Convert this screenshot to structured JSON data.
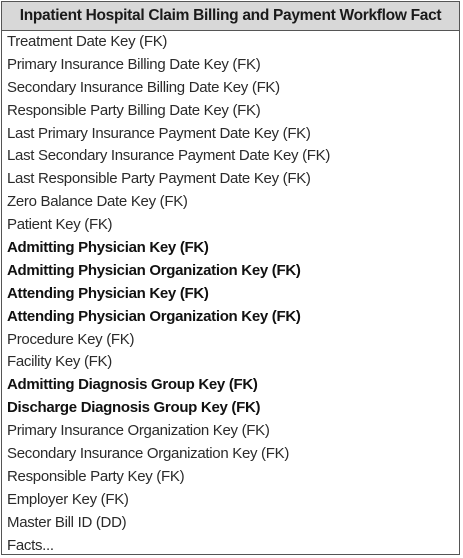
{
  "table": {
    "title": "Inpatient Hospital Claim Billing and Payment Workflow Fact",
    "rows": [
      {
        "label": "Treatment Date Key (FK)",
        "bold": false
      },
      {
        "label": "Primary Insurance Billing Date Key (FK)",
        "bold": false
      },
      {
        "label": "Secondary Insurance Billing Date Key (FK)",
        "bold": false
      },
      {
        "label": "Responsible Party Billing Date Key (FK)",
        "bold": false
      },
      {
        "label": "Last Primary Insurance Payment Date Key (FK)",
        "bold": false
      },
      {
        "label": "Last Secondary Insurance Payment Date Key (FK)",
        "bold": false
      },
      {
        "label": "Last Responsible Party Payment Date Key (FK)",
        "bold": false
      },
      {
        "label": "Zero Balance Date Key (FK)",
        "bold": false
      },
      {
        "label": "Patient Key (FK)",
        "bold": false
      },
      {
        "label": "Admitting Physician Key (FK)",
        "bold": true
      },
      {
        "label": "Admitting Physician Organization Key (FK)",
        "bold": true
      },
      {
        "label": "Attending Physician Key (FK)",
        "bold": true
      },
      {
        "label": "Attending Physician Organization Key (FK)",
        "bold": true
      },
      {
        "label": "Procedure Key (FK)",
        "bold": false
      },
      {
        "label": "Facility Key (FK)",
        "bold": false
      },
      {
        "label": "Admitting Diagnosis Group Key (FK)",
        "bold": true
      },
      {
        "label": "Discharge Diagnosis Group Key (FK)",
        "bold": true
      },
      {
        "label": "Primary Insurance Organization Key (FK)",
        "bold": false
      },
      {
        "label": "Secondary Insurance Organization Key (FK)",
        "bold": false
      },
      {
        "label": "Responsible Party Key (FK)",
        "bold": false
      },
      {
        "label": "Employer Key (FK)",
        "bold": false
      },
      {
        "label": "Master Bill ID (DD)",
        "bold": false
      },
      {
        "label": "Facts...",
        "bold": false
      }
    ]
  }
}
